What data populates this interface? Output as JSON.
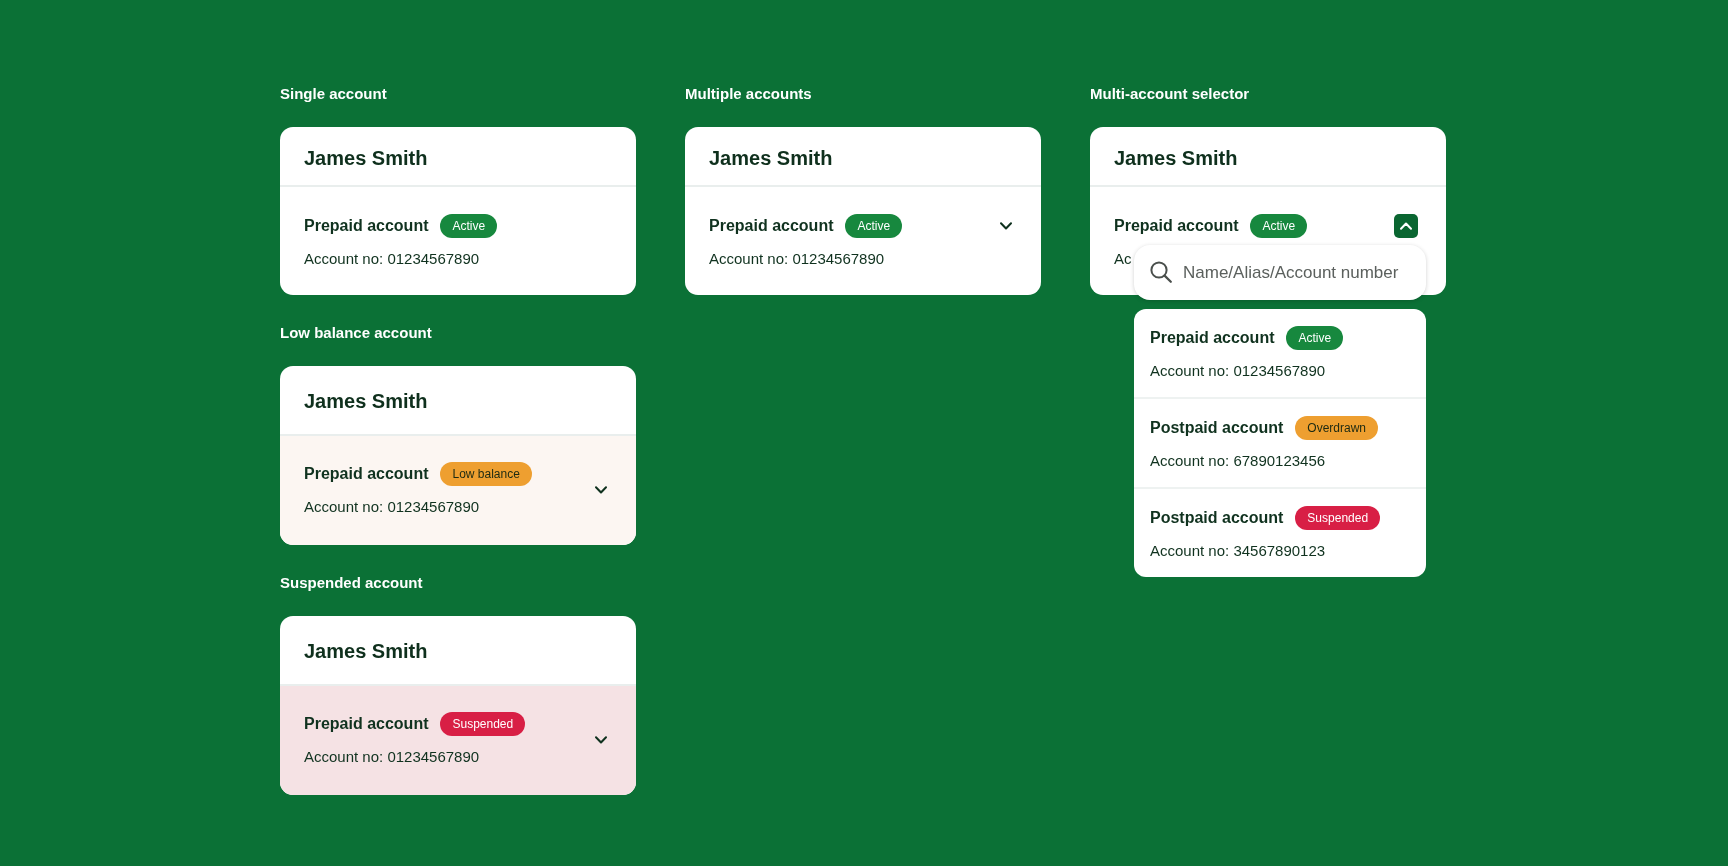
{
  "columns": [
    {
      "sections": [
        {
          "title": "Single account",
          "card": {
            "kind": "plain",
            "name": "James Smith",
            "account": {
              "type": "Prepaid account",
              "status": {
                "label": "Active",
                "color": "#17883e"
              },
              "number": "Account no: 01234567890"
            }
          }
        },
        {
          "title": "Low balance account",
          "card": {
            "kind": "warning",
            "name": "James Smith",
            "account": {
              "type": "Prepaid account",
              "status": {
                "label": "Low balance",
                "color": "#ee9f30"
              },
              "number": "Account no: 01234567890"
            },
            "expander": {
              "expanded": false
            }
          }
        },
        {
          "title": "Suspended account",
          "card": {
            "kind": "danger",
            "name": "James Smith",
            "account": {
              "type": "Prepaid account",
              "status": {
                "label": "Suspended",
                "color": "#d81f45"
              },
              "number": "Account no: 01234567890"
            },
            "expander": {
              "expanded": false
            }
          }
        }
      ]
    },
    {
      "sections": [
        {
          "title": "Multiple accounts",
          "card": {
            "kind": "plain",
            "name": "James Smith",
            "account": {
              "type": "Prepaid account",
              "status": {
                "label": "Active",
                "color": "#17883e"
              },
              "number": "Account no: 01234567890"
            },
            "expander": {
              "expanded": false
            }
          }
        }
      ]
    },
    {
      "sections": [
        {
          "title": "Multi-account selector",
          "card": {
            "kind": "plain",
            "name": "James Smith",
            "account": {
              "type": "Prepaid account",
              "status": {
                "label": "Active",
                "color": "#17883e"
              },
              "number": "Ac"
            },
            "expander": {
              "expanded": true
            },
            "selector": {
              "search": {
                "placeholder": "Name/Alias/Account number"
              },
              "accounts": [
                {
                  "type": "Prepaid account",
                  "status": {
                    "label": "Active",
                    "color": "#17883e"
                  },
                  "number": "Account no: 01234567890"
                },
                {
                  "type": "Postpaid account",
                  "status": {
                    "label": "Overdrawn",
                    "color": "#ee9f30"
                  },
                  "number": "Account no: 67890123456"
                },
                {
                  "type": "Postpaid account",
                  "status": {
                    "label": "Suspended",
                    "color": "#d81f45"
                  },
                  "number": "Account no: 34567890123"
                }
              ]
            }
          }
        }
      ]
    }
  ]
}
